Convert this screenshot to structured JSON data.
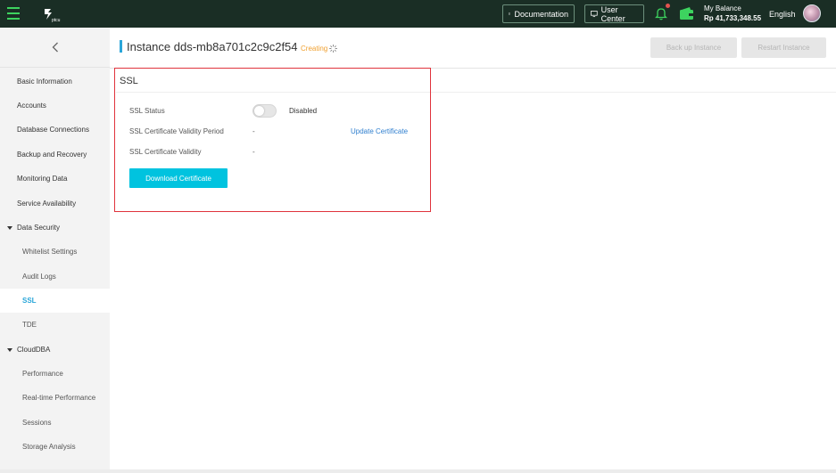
{
  "header": {
    "menu_icon": "hamburger-icon",
    "logo_icon": "cloud-logo-icon",
    "documentation_label": "Documentation",
    "user_center_label": "User Center",
    "balance_label": "My Balance",
    "balance_value": "Rp 41,733,348.55",
    "language": "English"
  },
  "sidebar": {
    "collapse_icon": "chevron-left-icon",
    "items": [
      {
        "label": "Basic Information"
      },
      {
        "label": "Accounts"
      },
      {
        "label": "Database Connections"
      },
      {
        "label": "Backup and Recovery"
      },
      {
        "label": "Monitoring Data"
      },
      {
        "label": "Service Availability"
      },
      {
        "label": "Data Security"
      },
      {
        "label": "Whitelist Settings"
      },
      {
        "label": "Audit Logs"
      },
      {
        "label": "SSL"
      },
      {
        "label": "TDE"
      },
      {
        "label": "CloudDBA"
      },
      {
        "label": "Performance"
      },
      {
        "label": "Real-time Performance"
      },
      {
        "label": "Sessions"
      },
      {
        "label": "Storage Analysis"
      }
    ]
  },
  "main": {
    "title": "Instance dds-mb8a701c2c9c2f54",
    "status": "Creating",
    "backup_button": "Back up Instance",
    "restart_button": "Restart Instance",
    "section_title": "SSL",
    "ssl_status_label": "SSL Status",
    "ssl_status_value": "Disabled",
    "validity_period_label": "SSL Certificate Validity Period",
    "validity_period_value": "-",
    "update_link": "Update Certificate",
    "validity_label": "SSL Certificate Validity",
    "validity_value": "-",
    "download_button": "Download Certificate"
  },
  "colors": {
    "header_bg": "#1a2e25",
    "accent": "#00c3df",
    "active_nav": "#2aa6d9",
    "highlight_box": "#e0333c",
    "status_color": "#f0a030"
  }
}
